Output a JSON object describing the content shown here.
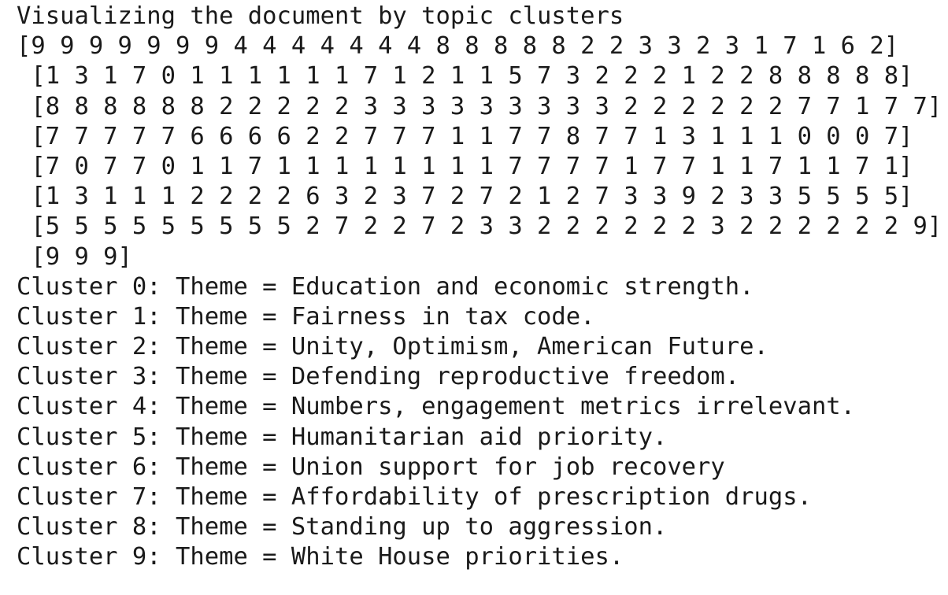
{
  "output": {
    "header": "Visualizing the document by topic clusters",
    "array_lines": [
      "[9 9 9 9 9 9 9 4 4 4 4 4 4 4 8 8 8 8 8 2 2 3 3 2 3 1 7 1 6 2]",
      " [1 3 1 7 0 1 1 1 1 1 1 7 1 2 1 1 5 7 3 2 2 2 1 2 2 8 8 8 8 8]",
      " [8 8 8 8 8 8 2 2 2 2 2 3 3 3 3 3 3 3 3 3 2 2 2 2 2 2 7 7 1 7 7]",
      " [7 7 7 7 7 6 6 6 6 2 2 7 7 7 1 1 7 7 8 7 7 1 3 1 1 1 0 0 0 7]",
      " [7 0 7 7 0 1 1 7 1 1 1 1 1 1 1 1 7 7 7 7 1 7 7 1 1 7 1 1 7 1]",
      " [1 3 1 1 1 2 2 2 2 6 3 2 3 7 2 7 2 1 2 7 3 3 9 2 3 3 5 5 5 5]",
      " [5 5 5 5 5 5 5 5 5 2 7 2 2 7 2 3 3 2 2 2 2 2 2 3 2 2 2 2 2 2 9]",
      " [9 9 9]"
    ],
    "clusters": [
      "Cluster 0: Theme = Education and economic strength.",
      "Cluster 1: Theme = Fairness in tax code.",
      "Cluster 2: Theme = Unity, Optimism, American Future.",
      "Cluster 3: Theme = Defending reproductive freedom.",
      "Cluster 4: Theme = Numbers, engagement metrics irrelevant.",
      "Cluster 5: Theme = Humanitarian aid priority.",
      "Cluster 6: Theme = Union support for job recovery",
      "Cluster 7: Theme = Affordability of prescription drugs.",
      "Cluster 8: Theme = Standing up to aggression.",
      "Cluster 9: Theme = White House priorities."
    ]
  }
}
